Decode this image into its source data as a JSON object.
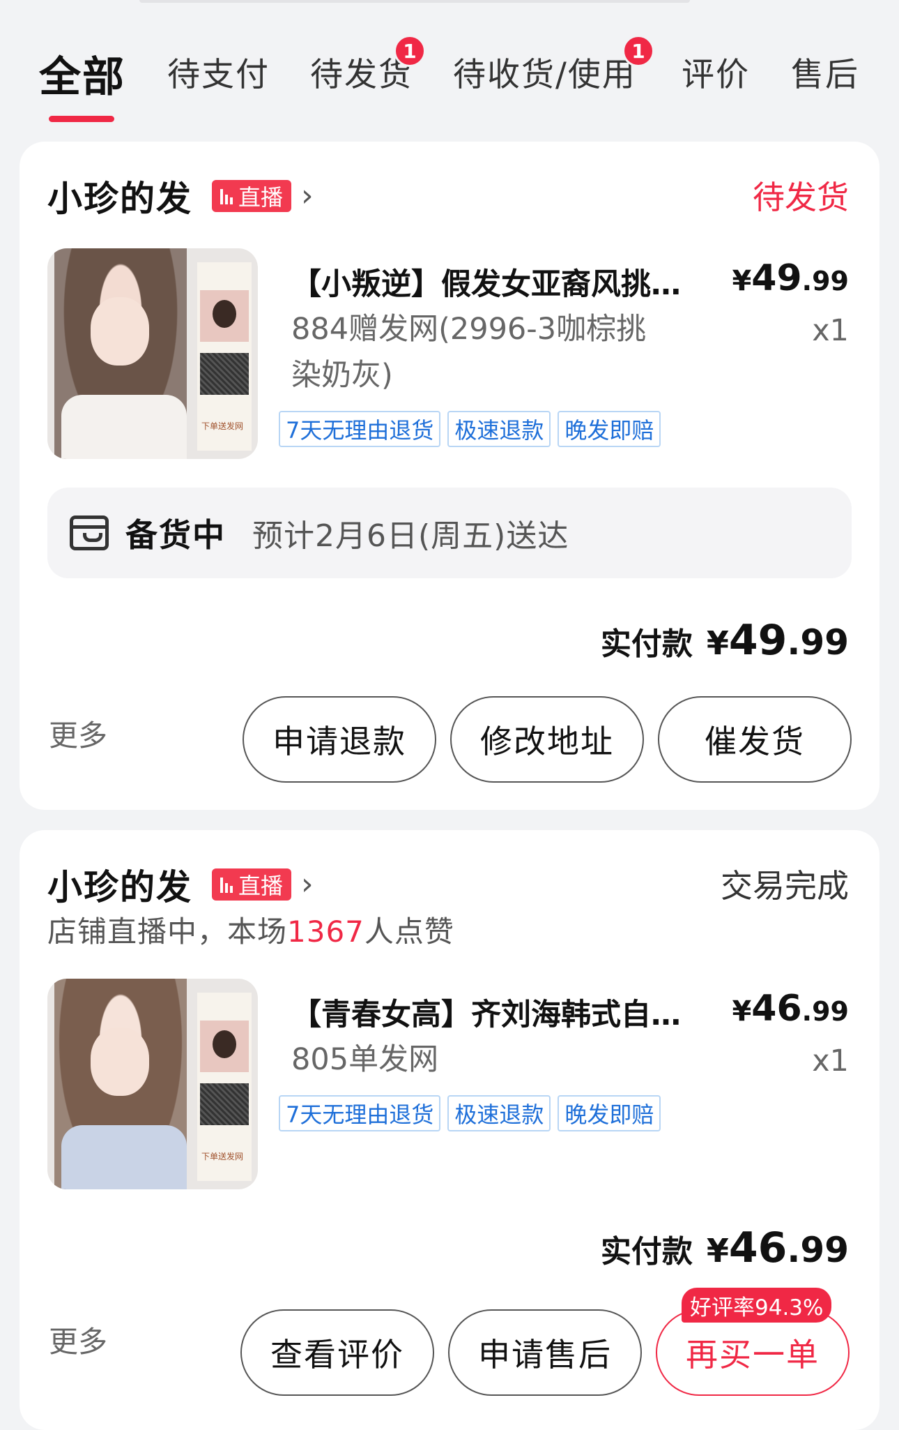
{
  "tabs": [
    {
      "label": "全部",
      "active": true
    },
    {
      "label": "待支付"
    },
    {
      "label": "待发货",
      "badge": "1"
    },
    {
      "label": "待收货/使用",
      "badge": "1"
    },
    {
      "label": "评价"
    },
    {
      "label": "售后"
    }
  ],
  "orders": [
    {
      "shop_name": "小珍的发",
      "live_label": "直播",
      "status": "待发货",
      "product": {
        "title": "【小叛逆】假发女亚裔风挑…",
        "price_currency": "¥",
        "price_int": "49",
        "price_dec": ".99",
        "spec": "884赠发网(2996-3咖棕挑染奶灰)",
        "qty": "x1",
        "tags": [
          "7天无理由退货",
          "极速退款",
          "晚发即赔"
        ],
        "thumb_text": "下单送发网"
      },
      "delivery": {
        "status": "备货中",
        "eta": "预计2月6日(周五)送达"
      },
      "paid_label": "实付款",
      "paid_currency": "¥",
      "paid_int": "49",
      "paid_dec": ".99",
      "more_label": "更多",
      "buttons": [
        "申请退款",
        "修改地址",
        "催发货"
      ]
    },
    {
      "shop_name": "小珍的发",
      "live_label": "直播",
      "status": "交易完成",
      "live_note_prefix": "店铺直播中，本场",
      "live_note_count": "1367",
      "live_note_suffix": "人点赞",
      "product": {
        "title": "【青春女高】齐刘海韩式自…",
        "price_currency": "¥",
        "price_int": "46",
        "price_dec": ".99",
        "spec": "805单发网",
        "qty": "x1",
        "tags": [
          "7天无理由退货",
          "极速退款",
          "晚发即赔"
        ],
        "thumb_text": "下单送发网"
      },
      "paid_label": "实付款",
      "paid_currency": "¥",
      "paid_int": "46",
      "paid_dec": ".99",
      "more_label": "更多",
      "buttons": [
        "查看评价",
        "申请售后",
        "再买一单"
      ],
      "rate_tag": "好评率94.3%"
    }
  ],
  "colors": {
    "accent": "#f02845",
    "tag_blue": "#1e6fd9",
    "background": "#f2f3f5"
  }
}
